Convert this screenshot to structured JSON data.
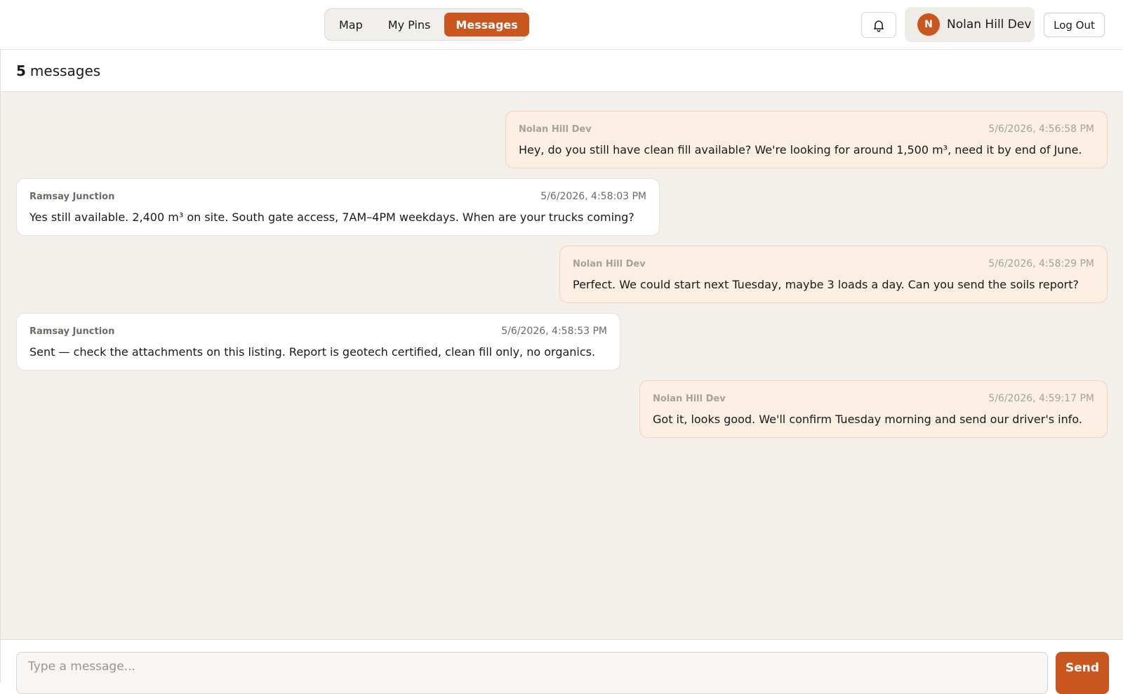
{
  "nav": {
    "tabs": [
      {
        "label": "Map",
        "active": false
      },
      {
        "label": "My Pins",
        "active": false
      },
      {
        "label": "Messages",
        "active": true
      }
    ]
  },
  "header": {
    "notifications_icon": "bell-icon",
    "user": {
      "initial": "N",
      "name": "Nolan Hill Dev"
    },
    "logout_label": "Log Out"
  },
  "thread": {
    "count": "5",
    "count_label": "messages",
    "messages": [
      {
        "from": "Nolan Hill Dev",
        "mine": true,
        "time": "5/6/2026, 4:56:58 PM",
        "text": "Hey, do you still have clean fill available? We're looking for around 1,500 m³, need it by end of June."
      },
      {
        "from": "Ramsay Junction",
        "mine": false,
        "time": "5/6/2026, 4:58:03 PM",
        "text": "Yes still available. 2,400 m³ on site. South gate access, 7AM–4PM weekdays. When are your trucks coming?"
      },
      {
        "from": "Nolan Hill Dev",
        "mine": true,
        "time": "5/6/2026, 4:58:29 PM",
        "text": "Perfect. We could start next Tuesday, maybe 3 loads a day. Can you send the soils report?"
      },
      {
        "from": "Ramsay Junction",
        "mine": false,
        "time": "5/6/2026, 4:58:53 PM",
        "text": "Sent — check the attachments on this listing. Report is geotech certified, clean fill only, no organics."
      },
      {
        "from": "Nolan Hill Dev",
        "mine": true,
        "time": "5/6/2026, 4:59:17 PM",
        "text": "Got it, looks good. We'll confirm Tuesday morning and send our driver's info."
      }
    ]
  },
  "composer": {
    "placeholder": "Type a message...",
    "value": "",
    "send_label": "Send"
  },
  "colors": {
    "accent": "#c9561f",
    "mine_bubble": "#fbeee3",
    "theirs_bubble": "#ffffff",
    "thread_bg": "#f3f0ec"
  }
}
